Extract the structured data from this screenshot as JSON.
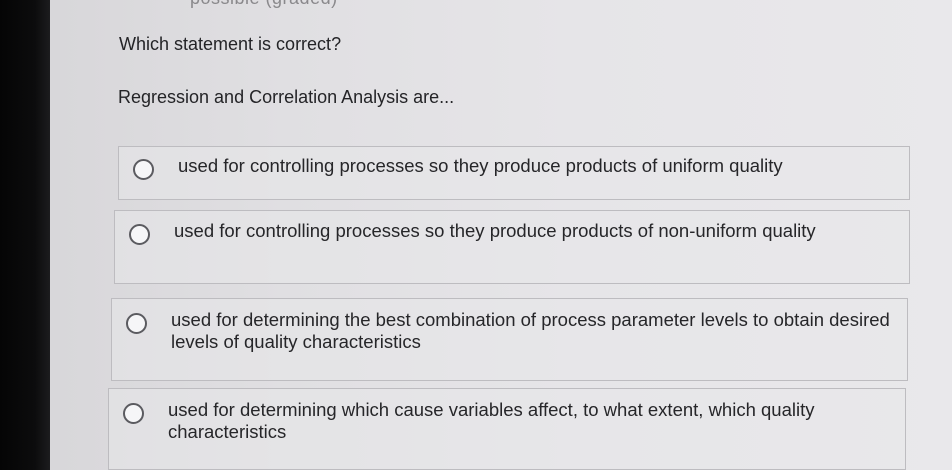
{
  "header_cut_text": "possible (graded)",
  "question": "Which statement is correct?",
  "prompt": "Regression and Correlation Analysis are...",
  "options": [
    {
      "label": "used for controlling processes so they produce products of uniform quality",
      "selected": false
    },
    {
      "label": "used for controlling processes so they produce products of non-uniform quality",
      "selected": false
    },
    {
      "label": "used for determining the best combination of process parameter levels to obtain desired levels of quality characteristics",
      "selected": false
    },
    {
      "label": "used for determining which cause variables affect, to what extent, which quality characteristics",
      "selected": false
    }
  ]
}
